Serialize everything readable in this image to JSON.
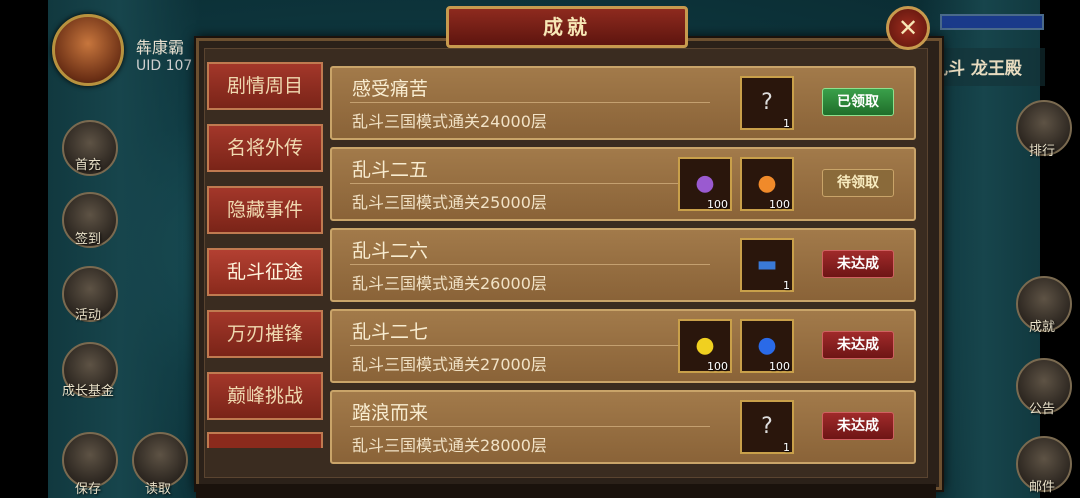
{
  "player": {
    "name": "犇康霸",
    "uid": "UID 107"
  },
  "top_right_banner": "乱斗 龙王殿",
  "left_side_icons": [
    {
      "label": "首充"
    },
    {
      "label": "签到"
    },
    {
      "label": "活动"
    },
    {
      "label": "成长基金"
    },
    {
      "label": "保存"
    },
    {
      "label": "读取"
    }
  ],
  "right_side_icons": [
    {
      "label": "排行"
    },
    {
      "label": "成就"
    },
    {
      "label": "公告"
    },
    {
      "label": "邮件"
    }
  ],
  "dialog": {
    "title": "成就",
    "close_symbol": "✕",
    "tabs": [
      {
        "label": "剧情周目",
        "active": false
      },
      {
        "label": "名将外传",
        "active": false
      },
      {
        "label": "隐藏事件",
        "active": false
      },
      {
        "label": "乱斗征途",
        "active": true
      },
      {
        "label": "万刃摧锋",
        "active": false
      },
      {
        "label": "巅峰挑战",
        "active": false
      }
    ],
    "rows": [
      {
        "title": "感受痛苦",
        "desc": "乱斗三国模式通关24000层",
        "rewards": [
          {
            "icon": "mystery-box-icon",
            "count": "1"
          }
        ],
        "status": "已领取",
        "status_type": "done"
      },
      {
        "title": "乱斗二五",
        "desc": "乱斗三国模式通关25000层",
        "rewards": [
          {
            "icon": "purple-fruit-icon",
            "count": "100"
          },
          {
            "icon": "orange-fruit-icon",
            "count": "100"
          }
        ],
        "status": "待领取",
        "status_type": "wait"
      },
      {
        "title": "乱斗二六",
        "desc": "乱斗三国模式通关26000层",
        "rewards": [
          {
            "icon": "blue-scroll-icon",
            "count": "1"
          }
        ],
        "status": "未达成",
        "status_type": "no"
      },
      {
        "title": "乱斗二七",
        "desc": "乱斗三国模式通关27000层",
        "rewards": [
          {
            "icon": "yellow-fruit-icon",
            "count": "100"
          },
          {
            "icon": "blue-fruit-icon",
            "count": "100"
          }
        ],
        "status": "未达成",
        "status_type": "no"
      },
      {
        "title": "踏浪而来",
        "desc": "乱斗三国模式通关28000层",
        "rewards": [
          {
            "icon": "mystery-box-icon",
            "count": "1"
          }
        ],
        "status": "未达成",
        "status_type": "no"
      }
    ]
  }
}
